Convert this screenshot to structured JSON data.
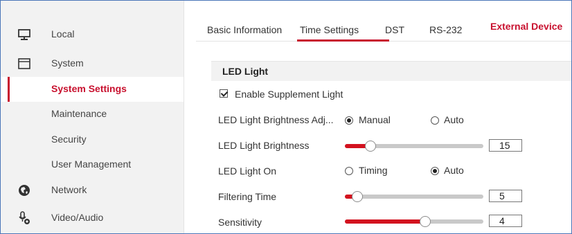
{
  "sidebar": {
    "local": "Local",
    "system": "System",
    "system_settings": "System Settings",
    "maintenance": "Maintenance",
    "security": "Security",
    "user_management": "User Management",
    "network": "Network",
    "video_audio": "Video/Audio"
  },
  "tabs": {
    "basic_information": "Basic Information",
    "time_settings": "Time Settings",
    "dst": "DST",
    "rs232": "RS-232",
    "external_device": "External Device"
  },
  "section": {
    "title": "LED Light"
  },
  "enable_supplement_light": {
    "label": "Enable Supplement Light",
    "checked": true
  },
  "brightness_adjust": {
    "label": "LED Light Brightness Adj...",
    "manual": "Manual",
    "auto": "Auto",
    "selected": "Manual"
  },
  "brightness": {
    "label": "LED Light Brightness",
    "value": "15",
    "level": 0.15
  },
  "light_on": {
    "label": "LED Light On",
    "timing": "Timing",
    "auto": "Auto",
    "selected": "Auto"
  },
  "filtering_time": {
    "label": "Filtering Time",
    "value": "5",
    "level": 0.05
  },
  "sensitivity": {
    "label": "Sensitivity",
    "value": "4",
    "level": 0.56
  },
  "colors": {
    "accent": "#c8102e",
    "slider_fill": "#d3121f",
    "frame_border": "#4a76b8"
  }
}
